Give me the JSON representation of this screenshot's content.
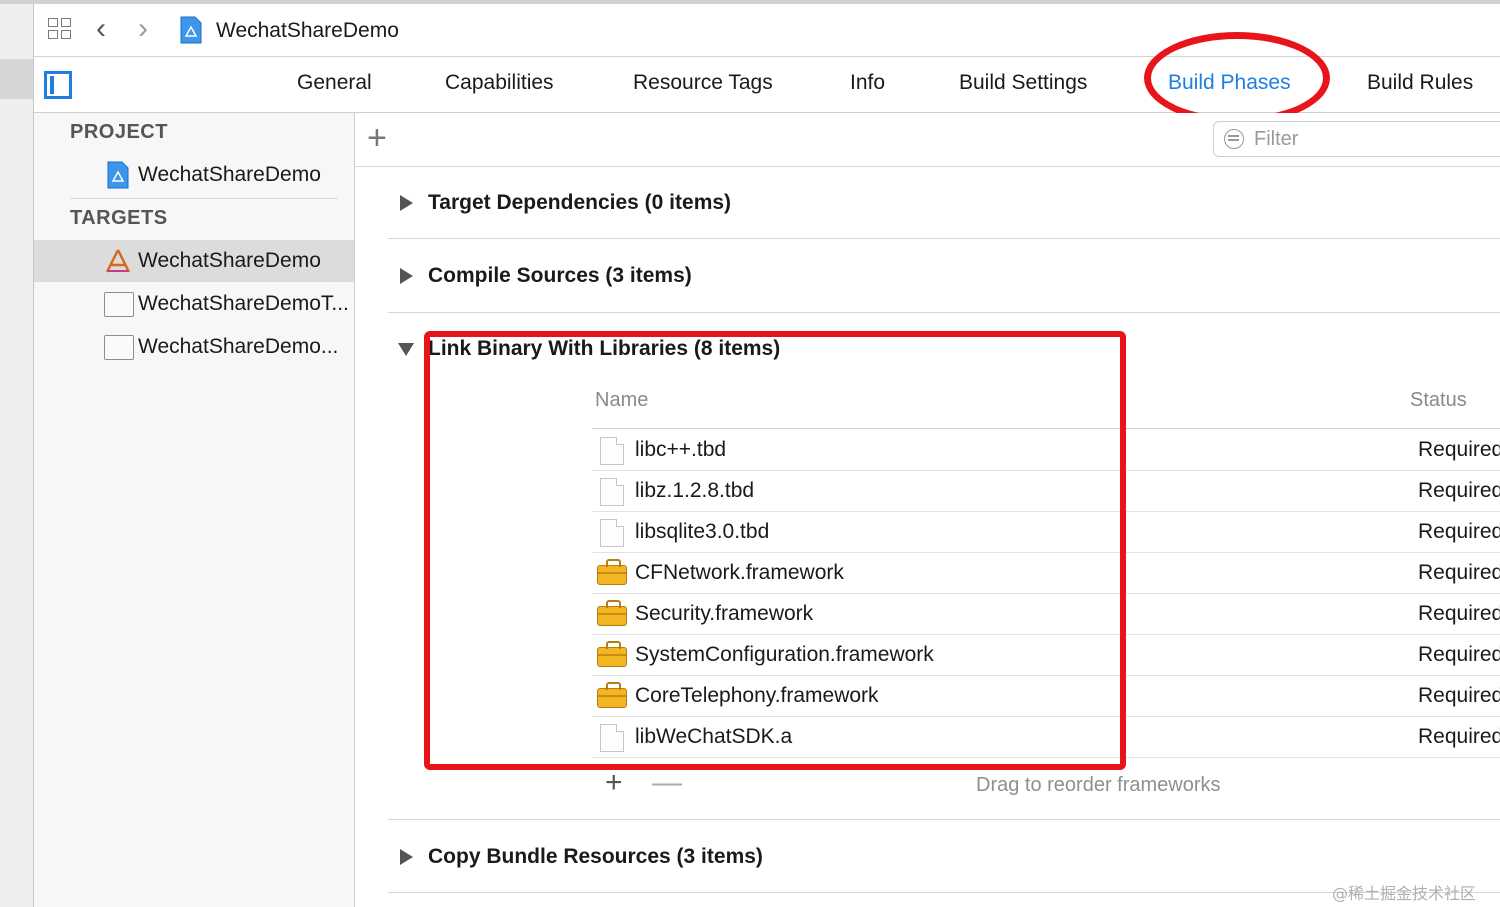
{
  "window": {
    "title": "WechatShareDemo"
  },
  "toolbar": {
    "grid_icon": "grid-icon",
    "back_icon": "chevron-left-icon",
    "forward_icon": "chevron-right-icon",
    "back_glyph": "‹",
    "forward_glyph": "›"
  },
  "tabs": [
    {
      "label": "General",
      "active": false
    },
    {
      "label": "Capabilities",
      "active": false
    },
    {
      "label": "Resource Tags",
      "active": false
    },
    {
      "label": "Info",
      "active": false
    },
    {
      "label": "Build Settings",
      "active": false
    },
    {
      "label": "Build Phases",
      "active": true
    },
    {
      "label": "Build Rules",
      "active": false
    }
  ],
  "sidebar": {
    "project_header": "PROJECT",
    "project_item": "WechatShareDemo",
    "targets_header": "TARGETS",
    "targets": [
      {
        "label": "WechatShareDemo",
        "selected": true,
        "icon": "app-target-icon"
      },
      {
        "label": "WechatShareDemoT...",
        "selected": false,
        "icon": "bundle-icon"
      },
      {
        "label": "WechatShareDemo...",
        "selected": false,
        "icon": "bundle-icon"
      }
    ]
  },
  "main": {
    "add_glyph": "+",
    "filter_placeholder": "Filter",
    "phases": {
      "target_dependencies": "Target Dependencies (0 items)",
      "compile_sources": "Compile Sources (3 items)",
      "link_binary": "Link Binary With Libraries (8 items)",
      "copy_bundle": "Copy Bundle Resources (3 items)"
    },
    "link_table": {
      "col_name": "Name",
      "col_status": "Status",
      "rows": [
        {
          "name": "libc++.tbd",
          "status": "Required",
          "icon": "file-icon"
        },
        {
          "name": "libz.1.2.8.tbd",
          "status": "Required",
          "icon": "file-icon"
        },
        {
          "name": "libsqlite3.0.tbd",
          "status": "Required",
          "icon": "file-icon"
        },
        {
          "name": "CFNetwork.framework",
          "status": "Required",
          "icon": "framework-icon"
        },
        {
          "name": "Security.framework",
          "status": "Required",
          "icon": "framework-icon"
        },
        {
          "name": "SystemConfiguration.framework",
          "status": "Required",
          "icon": "framework-icon"
        },
        {
          "name": "CoreTelephony.framework",
          "status": "Required",
          "icon": "framework-icon"
        },
        {
          "name": "libWeChatSDK.a",
          "status": "Required",
          "icon": "file-icon"
        }
      ],
      "add_glyph": "+",
      "remove_glyph": "—",
      "drag_hint": "Drag to reorder frameworks"
    }
  },
  "annotations": {
    "highlight_color": "#e8141b"
  },
  "watermark": "@稀土掘金技术社区",
  "colors": {
    "accent": "#1f7ee0"
  }
}
